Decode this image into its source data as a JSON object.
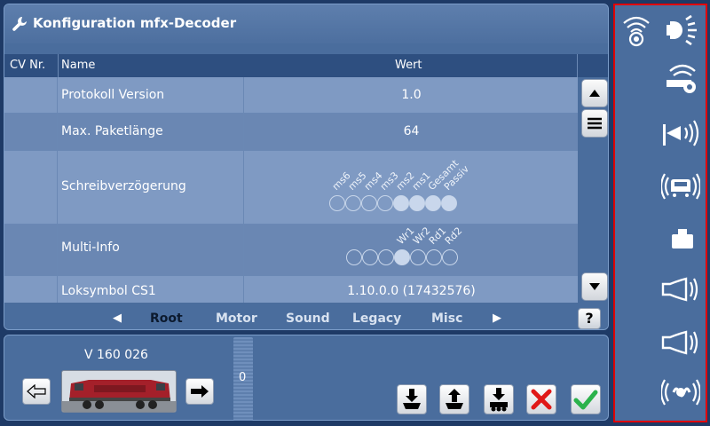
{
  "window": {
    "title": "Konfiguration mfx-Decoder"
  },
  "table": {
    "headers": {
      "cv": "CV Nr.",
      "name": "Name",
      "value": "Wert"
    },
    "rows": [
      {
        "name": "Protokoll Version",
        "value": "1.0"
      },
      {
        "name": "Max. Paketlänge",
        "value": "64"
      },
      {
        "name": "Schreibverzögerung",
        "value": ""
      },
      {
        "name": "Multi-Info",
        "value": ""
      },
      {
        "name": "Loksymbol CS1",
        "value": "1.10.0.0 (17432576)"
      }
    ],
    "schreib_bits": [
      {
        "label": "ms6",
        "on": false
      },
      {
        "label": "ms5",
        "on": false
      },
      {
        "label": "ms4",
        "on": false
      },
      {
        "label": "ms3",
        "on": false
      },
      {
        "label": "ms2",
        "on": true
      },
      {
        "label": "ms1",
        "on": true
      },
      {
        "label": "Gesamt",
        "on": true
      },
      {
        "label": "Passiv",
        "on": true
      }
    ],
    "multi_bits": [
      {
        "label": "",
        "on": false
      },
      {
        "label": "",
        "on": false
      },
      {
        "label": "",
        "on": false
      },
      {
        "label": "Wr1",
        "on": true
      },
      {
        "label": "Wr2",
        "on": false
      },
      {
        "label": "Rd1",
        "on": false
      },
      {
        "label": "Rd2",
        "on": false
      }
    ]
  },
  "tabs": {
    "items": [
      "Root",
      "Motor",
      "Sound",
      "Legacy",
      "Misc"
    ],
    "active": "Root",
    "help_label": "?"
  },
  "loco": {
    "name": "V 160 026",
    "speed": "0"
  },
  "colors": {
    "accent_red": "#e00000",
    "confirm_green": "#2bb24c",
    "cancel_red": "#e01818"
  },
  "sidebar_icons": [
    "radio-signal-icon",
    "headlight-icon",
    "whistle-icon",
    "horn-icon",
    "loco-sound-icon",
    "weight-icon",
    "bell-icon",
    "bell-icon-2",
    "sound-wave-icon"
  ]
}
